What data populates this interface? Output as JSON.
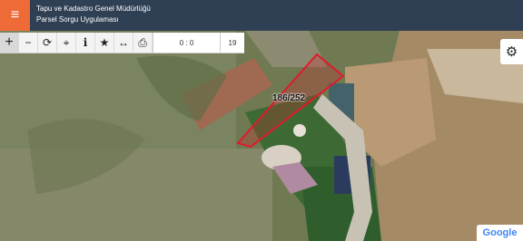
{
  "header": {
    "menu_icon": "hamburger-icon",
    "title_line1": "Tapu ve Kadastro Genel Müdürlüğü",
    "title_line2": "Parsel Sorgu Uygulaması",
    "background": "#2f3f54",
    "accent": "#ee6a36"
  },
  "toolbar": {
    "buttons": [
      {
        "icon": "plus-icon",
        "glyph": "+"
      },
      {
        "icon": "minus-icon",
        "glyph": "−"
      },
      {
        "icon": "refresh-icon",
        "glyph": "⟳"
      },
      {
        "icon": "crosshair-icon",
        "glyph": "⌖"
      },
      {
        "icon": "info-icon",
        "glyph": "i"
      },
      {
        "icon": "star-icon",
        "glyph": "★"
      },
      {
        "icon": "measure-icon",
        "glyph": "↔"
      },
      {
        "icon": "print-icon",
        "glyph": "⎙"
      }
    ],
    "coordinates": "0 : 0",
    "zoom_level": "19"
  },
  "map": {
    "parcel_label": "186/252",
    "parcel_color": "#e01a2b",
    "settings_icon": "gear-icon",
    "attribution": "Google"
  }
}
